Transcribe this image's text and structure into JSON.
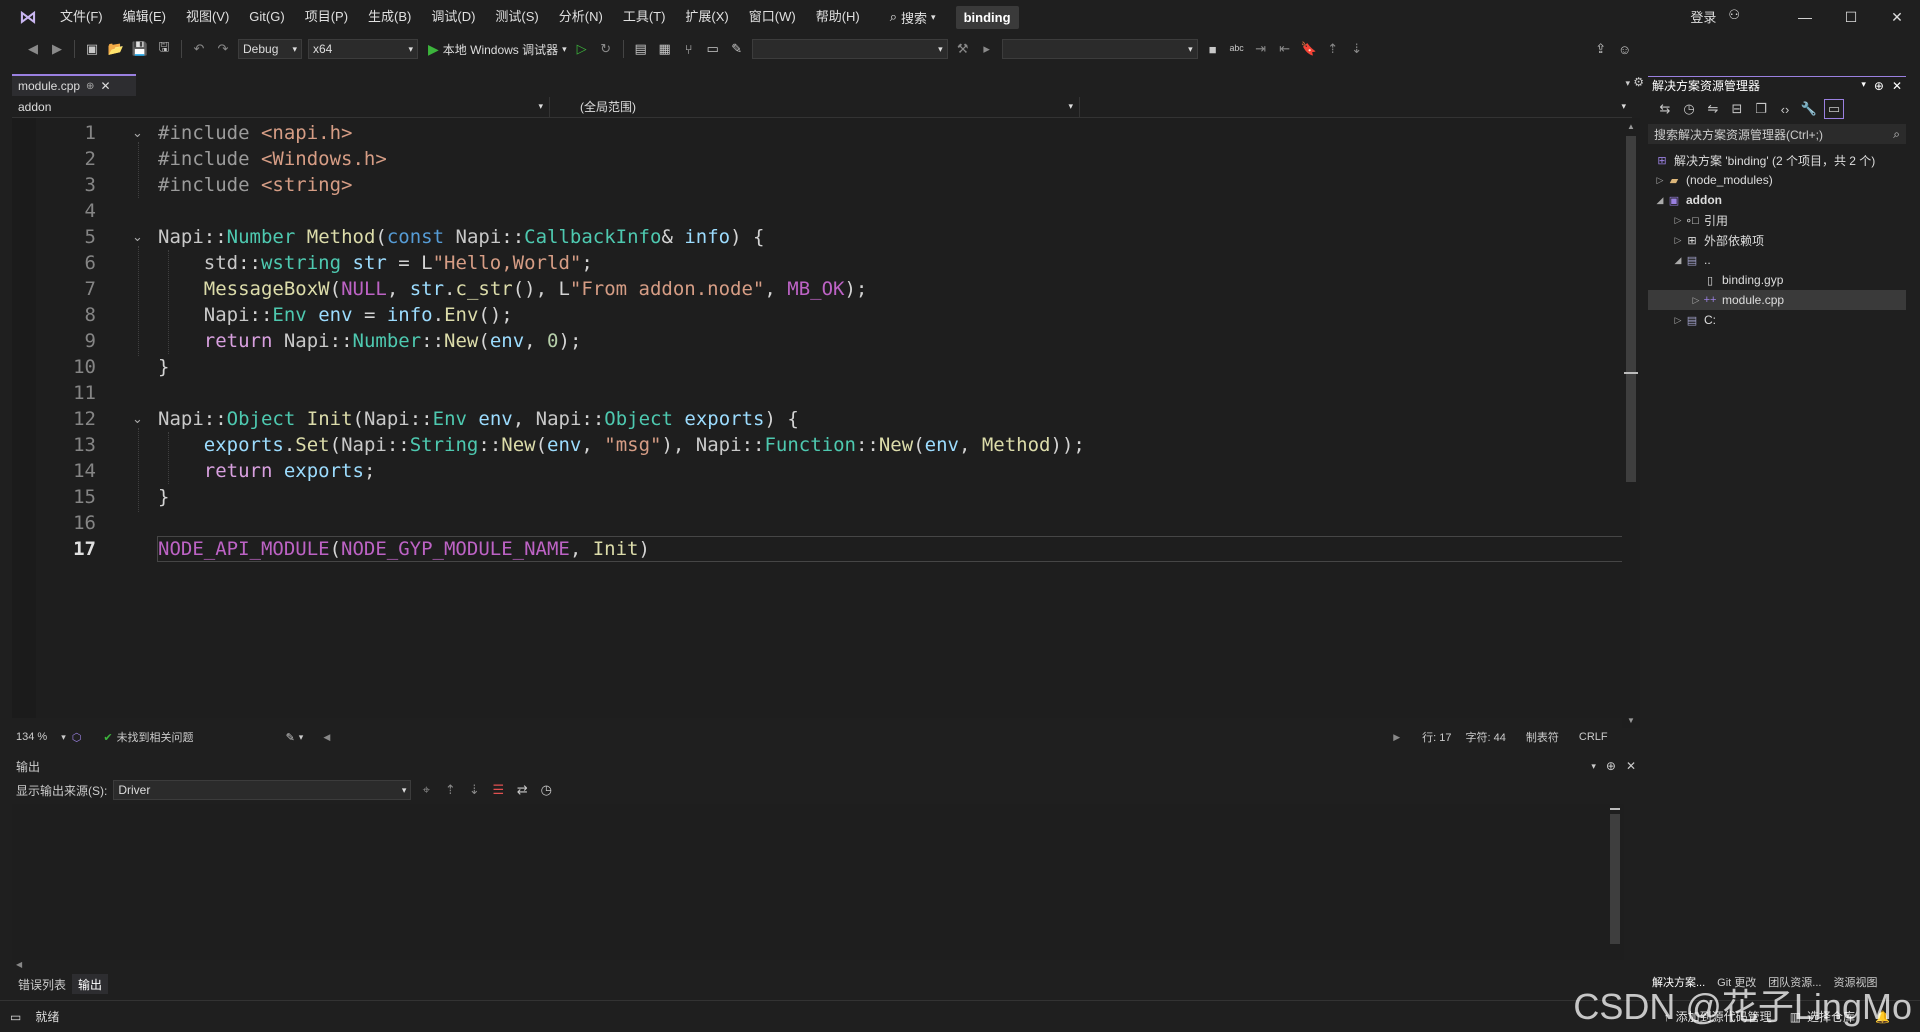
{
  "title_bar": {
    "menu": [
      "文件(F)",
      "编辑(E)",
      "视图(V)",
      "Git(G)",
      "项目(P)",
      "生成(B)",
      "调试(D)",
      "测试(S)",
      "分析(N)",
      "工具(T)",
      "扩展(X)",
      "窗口(W)",
      "帮助(H)"
    ],
    "search_label": "搜索",
    "solution_name": "binding",
    "login_label": "登录"
  },
  "toolbar": {
    "config": "Debug",
    "platform": "x64",
    "run_label": "本地 Windows 调试器"
  },
  "editor": {
    "tab_label": "module.cpp",
    "nav_project": "addon",
    "nav_scope": "(全局范围)",
    "current_line": 17
  },
  "code_lines": [
    "1",
    "2",
    "3",
    "4",
    "5",
    "6",
    "7",
    "8",
    "9",
    "10",
    "11",
    "12",
    "13",
    "14",
    "15",
    "16",
    "17"
  ],
  "status_row": {
    "zoom": "134 %",
    "issues": "未找到相关问题",
    "line": "行: 17",
    "col": "字符: 44",
    "indent": "制表符",
    "eol": "CRLF"
  },
  "output_panel": {
    "title": "输出",
    "source_label": "显示输出来源(S):",
    "source_value": "Driver",
    "tabs": [
      "错误列表",
      "输出"
    ]
  },
  "solution_explorer": {
    "title": "解决方案资源管理器",
    "search_placeholder": "搜索解决方案资源管理器(Ctrl+;)",
    "items": [
      {
        "label": "解决方案 'binding' (2 个项目，共 2 个)"
      },
      {
        "label": "(node_modules)"
      },
      {
        "label": "addon"
      },
      {
        "label": "引用"
      },
      {
        "label": "外部依赖项"
      },
      {
        "label": ".."
      },
      {
        "label": "binding.gyp"
      },
      {
        "label": "module.cpp"
      },
      {
        "label": "C:"
      }
    ],
    "bottom_tabs": [
      "解决方案...",
      "Git 更改",
      "团队资源...",
      "资源视图"
    ]
  },
  "status_bar": {
    "ready": "就绪",
    "add_source": "添加到源代码管理",
    "select_repo": "选择仓库"
  },
  "watermark": "CSDN @花子LingMo",
  "colors": {
    "accent": "#9a80e0",
    "keyword": "#569cd6",
    "type": "#4ec9b0",
    "func": "#dcdcaa",
    "string": "#d69d85"
  }
}
